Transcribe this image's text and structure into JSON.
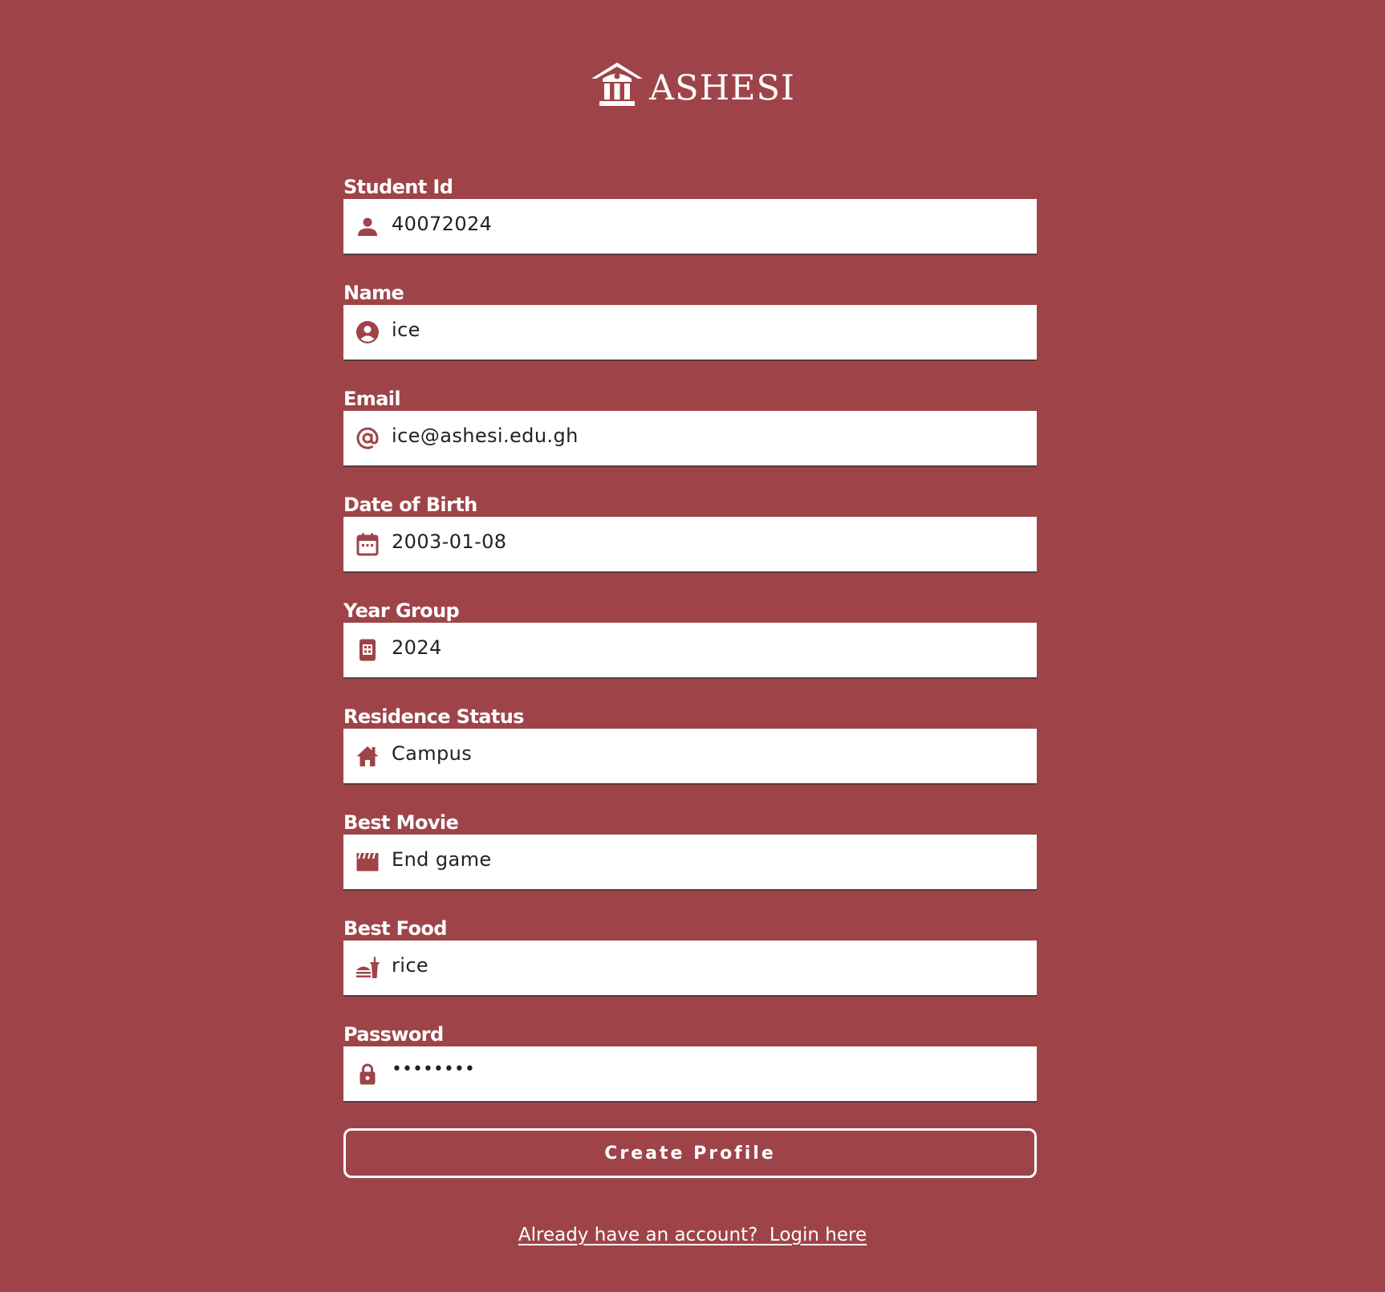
{
  "brand": {
    "name": "ASHESI",
    "logo_icon": "university-building-icon"
  },
  "colors": {
    "background": "#9e4448",
    "accent": "#9e4448",
    "input_background": "#ffffff",
    "text": "#ffffff"
  },
  "form": {
    "fields": [
      {
        "key": "student_id",
        "label": "Student Id",
        "value": "40072024",
        "icon": "person-icon"
      },
      {
        "key": "name",
        "label": "Name",
        "value": "ice",
        "icon": "account-circle-icon"
      },
      {
        "key": "email",
        "label": "Email",
        "value": "ice@ashesi.edu.gh",
        "icon": "at-sign-icon"
      },
      {
        "key": "date_of_birth",
        "label": "Date of Birth",
        "value": "2003-01-08",
        "icon": "calendar-icon"
      },
      {
        "key": "year_group",
        "label": "Year Group",
        "value": "2024",
        "icon": "calculator-icon"
      },
      {
        "key": "residence_status",
        "label": "Residence Status",
        "value": "Campus",
        "icon": "home-icon"
      },
      {
        "key": "best_movie",
        "label": "Best Movie",
        "value": "End game",
        "icon": "clapperboard-icon"
      },
      {
        "key": "best_food",
        "label": "Best Food",
        "value": "rice",
        "icon": "fastfood-icon"
      },
      {
        "key": "password",
        "label": "Password",
        "value": "••••••••",
        "icon": "lock-icon"
      }
    ],
    "submit_label": "Create Profile"
  },
  "footer": {
    "login_link": "Already have an account?  Login here"
  }
}
